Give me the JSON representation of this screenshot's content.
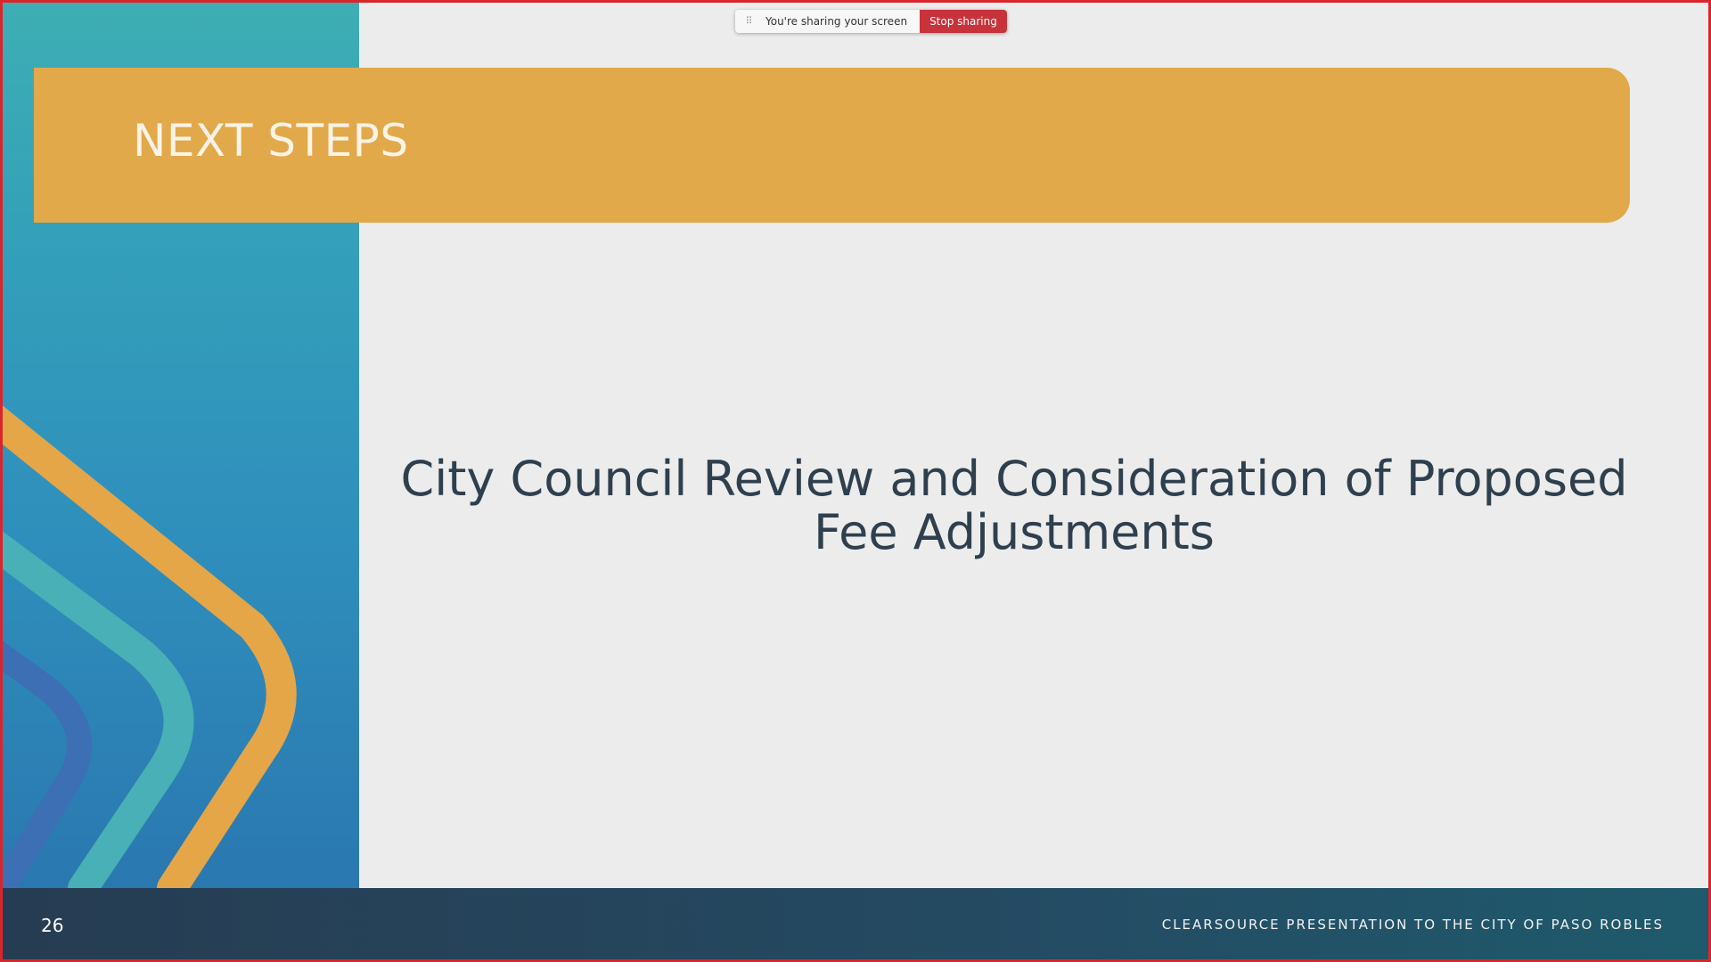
{
  "share_bar": {
    "status_text": "You're sharing your screen",
    "stop_label": "Stop sharing",
    "drag_icon": "drag-handle-icon"
  },
  "slide": {
    "title": "NEXT STEPS",
    "body_line1": "City Council Review and Consideration of Proposed",
    "body_line2": "Fee Adjustments",
    "slide_number": "26",
    "footer_caption": "CLEARSOURCE PRESENTATION TO THE CITY OF PASO ROBLES"
  },
  "colors": {
    "frame_border": "#d8262c",
    "title_banner": "#e1a94a",
    "stop_button": "#c8323a",
    "footer": "#263c52",
    "left_panel": "#2f8fbc"
  }
}
